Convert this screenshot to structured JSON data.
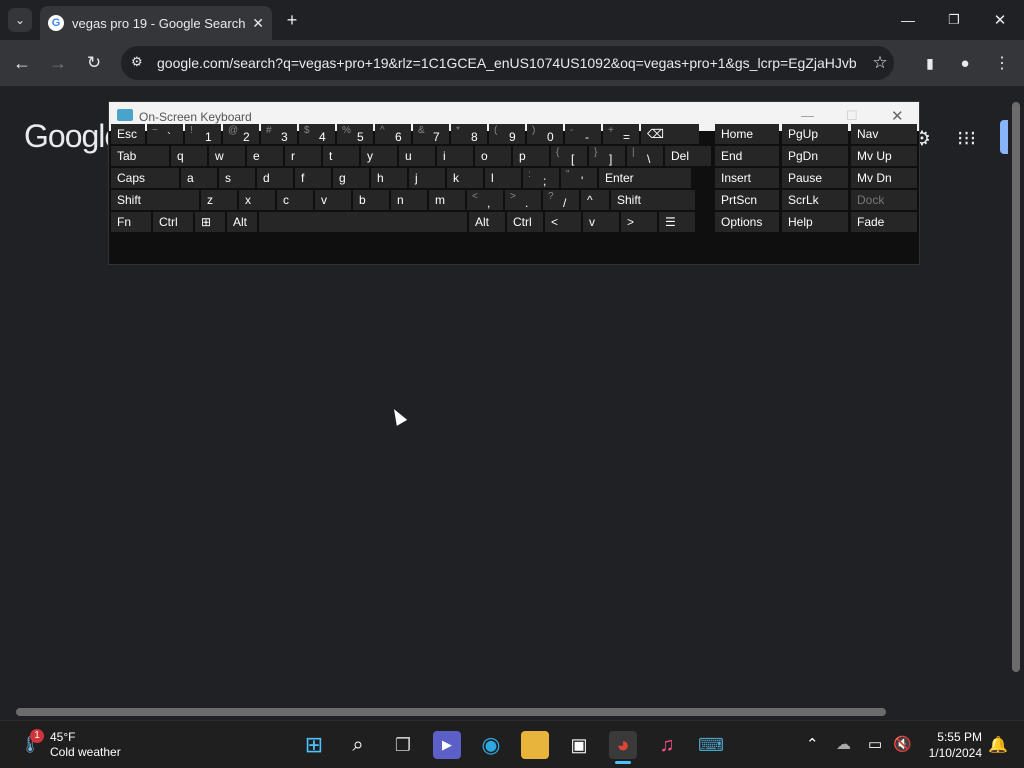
{
  "browser": {
    "tab_title": "vegas pro 19 - Google Search",
    "url": "google.com/search?q=vegas+pro+19&rlz=1C1GCEA_enUS1074US1092&oq=vegas+pro+1&gs_lcrp=EgZjaHJvb...",
    "logo_text": "Google",
    "colors": {
      "tabbar": "#202124",
      "toolbar": "#35363a",
      "accent": "#8ab4f8"
    }
  },
  "osk": {
    "title": "On-Screen Keyboard",
    "rows": [
      [
        {
          "label": "Esc"
        },
        {
          "shift": "~",
          "main": "`"
        },
        {
          "shift": "!",
          "main": "1"
        },
        {
          "shift": "@",
          "main": "2"
        },
        {
          "shift": "#",
          "main": "3"
        },
        {
          "shift": "$",
          "main": "4"
        },
        {
          "shift": "%",
          "main": "5"
        },
        {
          "shift": "^",
          "main": "6"
        },
        {
          "shift": "&",
          "main": "7"
        },
        {
          "shift": "*",
          "main": "8"
        },
        {
          "shift": "(",
          "main": "9"
        },
        {
          "shift": ")",
          "main": "0"
        },
        {
          "shift": "-",
          "main": "-"
        },
        {
          "shift": "+",
          "main": "="
        },
        {
          "label": "⌫"
        }
      ],
      [
        {
          "label": "Tab"
        },
        {
          "label": "q"
        },
        {
          "label": "w"
        },
        {
          "label": "e"
        },
        {
          "label": "r"
        },
        {
          "label": "t"
        },
        {
          "label": "y"
        },
        {
          "label": "u"
        },
        {
          "label": "i"
        },
        {
          "label": "o"
        },
        {
          "label": "p"
        },
        {
          "shift": "{",
          "main": "["
        },
        {
          "shift": "}",
          "main": "]"
        },
        {
          "shift": "|",
          "main": "\\"
        },
        {
          "label": "Del"
        }
      ],
      [
        {
          "label": "Caps"
        },
        {
          "label": "a"
        },
        {
          "label": "s"
        },
        {
          "label": "d"
        },
        {
          "label": "f"
        },
        {
          "label": "g"
        },
        {
          "label": "h"
        },
        {
          "label": "j"
        },
        {
          "label": "k"
        },
        {
          "label": "l"
        },
        {
          "shift": ":",
          "main": ";"
        },
        {
          "shift": "\"",
          "main": "'"
        },
        {
          "label": "Enter"
        }
      ],
      [
        {
          "label": "Shift"
        },
        {
          "label": "z"
        },
        {
          "label": "x"
        },
        {
          "label": "c"
        },
        {
          "label": "v"
        },
        {
          "label": "b"
        },
        {
          "label": "n"
        },
        {
          "label": "m"
        },
        {
          "shift": "<",
          "main": ","
        },
        {
          "shift": ">",
          "main": "."
        },
        {
          "shift": "?",
          "main": "/"
        },
        {
          "label": "^"
        },
        {
          "label": "Shift"
        }
      ],
      [
        {
          "label": "Fn"
        },
        {
          "label": "Ctrl"
        },
        {
          "label": "⊞"
        },
        {
          "label": "Alt"
        },
        {
          "label": ""
        },
        {
          "label": "Alt"
        },
        {
          "label": "Ctrl"
        },
        {
          "label": "<"
        },
        {
          "label": "v"
        },
        {
          "label": ">"
        },
        {
          "label": "☰"
        }
      ]
    ],
    "nav_rows": [
      [
        "Home",
        "PgUp",
        "Nav"
      ],
      [
        "End",
        "PgDn",
        "Mv Up"
      ],
      [
        "Insert",
        "Pause",
        "Mv Dn"
      ],
      [
        "PrtScn",
        "ScrLk",
        "Dock"
      ],
      [
        "Options",
        "Help",
        "Fade"
      ]
    ]
  },
  "taskbar": {
    "weather_temp": "45°F",
    "weather_desc": "Cold weather",
    "weather_badge": "1",
    "time": "5:55 PM",
    "date": "1/10/2024"
  }
}
